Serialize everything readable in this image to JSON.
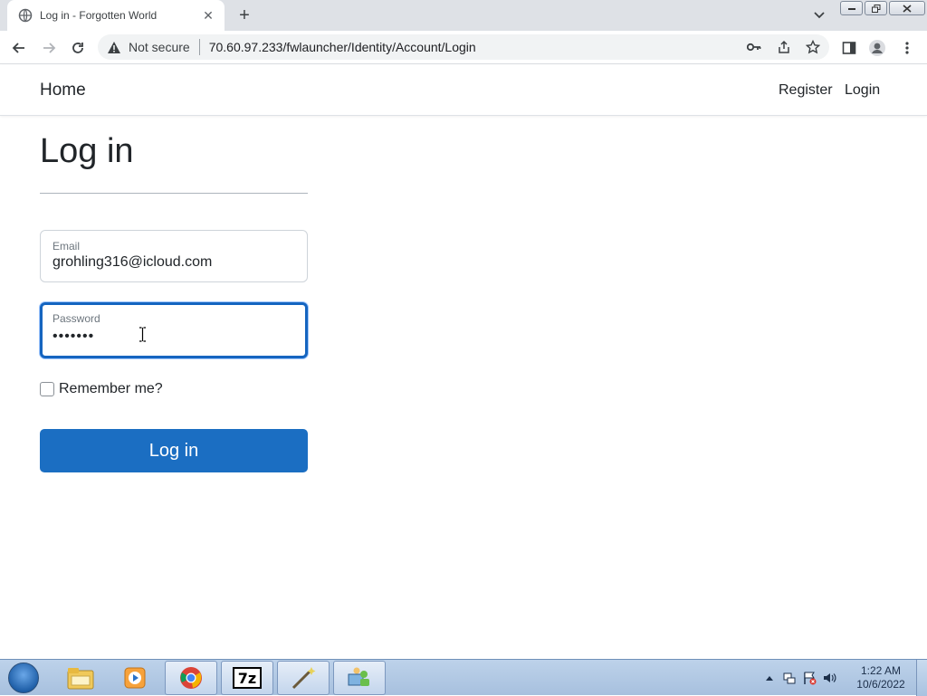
{
  "browser": {
    "tab_title": "Log in - Forgotten World",
    "tab_close": "✕",
    "new_tab": "+",
    "security_label": "Not secure",
    "url": "70.60.97.233/fwlauncher/Identity/Account/Login"
  },
  "navbar": {
    "brand": "Home",
    "links": [
      "Register",
      "Login"
    ]
  },
  "form": {
    "title": "Log in",
    "email_label": "Email",
    "email_value": "grohling316@icloud.com",
    "password_label": "Password",
    "password_value": "•••••••",
    "remember_label": "Remember me?",
    "remember_checked": false,
    "submit_label": "Log in"
  },
  "colors": {
    "primary": "#1b6ec2",
    "focus_border": "#1565c0",
    "text": "#212529"
  },
  "taskbar": {
    "items": [
      "explorer-icon",
      "media-player-icon",
      "chrome-icon",
      "7zip-icon",
      "wand-icon",
      "network-users-icon"
    ],
    "time": "1:22 AM",
    "date": "10/6/2022"
  }
}
